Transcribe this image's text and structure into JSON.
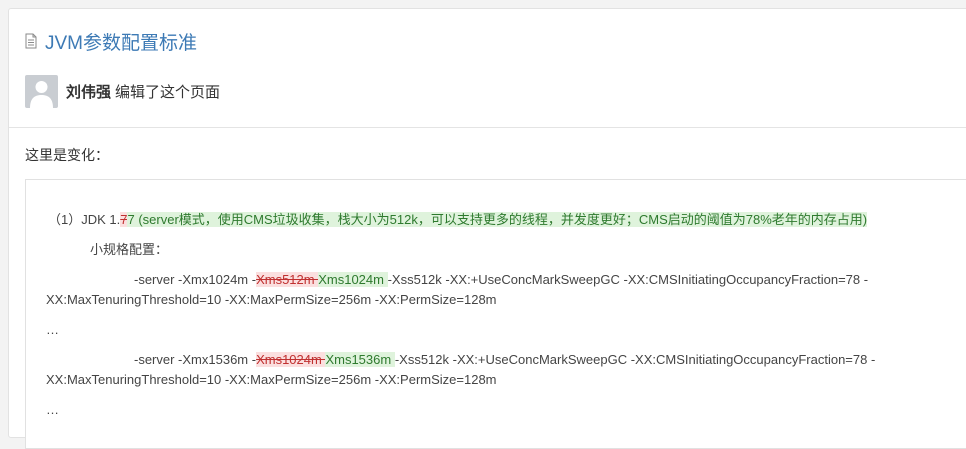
{
  "page": {
    "title": "JVM参数配置标准"
  },
  "activity": {
    "user_name": "刘伟强",
    "action": "编辑了这个页面"
  },
  "changes_label": "这里是变化：",
  "diff": {
    "line1": {
      "prefix": "（1）JDK 1.",
      "deleted": "7",
      "inserted": "7 (server模式，使用CMS垃圾收集，栈大小为512k，可以支持更多的线程，并发度更好；CMS启动的阈值为78%老年的内存占用)"
    },
    "line2": "小规格配置：",
    "block1": {
      "before": "-server -Xmx1024m -",
      "deleted": "Xms512m ",
      "inserted": "Xms1024m ",
      "after": "-Xss512k -XX:+UseConcMarkSweepGC  -XX:CMSInitiatingOccupancyFraction=78 -",
      "continuation": "XX:MaxTenuringThreshold=10 -XX:MaxPermSize=256m -XX:PermSize=128m"
    },
    "ellipsis1": "…",
    "block2": {
      "before": "-server -Xmx1536m -",
      "deleted": "Xms1024m ",
      "inserted": "Xms1536m ",
      "after": "-Xss512k -XX:+UseConcMarkSweepGC  -XX:CMSInitiatingOccupancyFraction=78 -",
      "continuation": "XX:MaxTenuringThreshold=10 -XX:MaxPermSize=256m -XX:PermSize=128m"
    },
    "ellipsis2": "…"
  },
  "colors": {
    "title": "#3d7ab5",
    "deleted_bg": "#fbdfdf",
    "inserted_bg": "#dff3dc"
  },
  "icons": {
    "title_icon": "document-icon",
    "avatar_icon": "user-silhouette-icon"
  }
}
